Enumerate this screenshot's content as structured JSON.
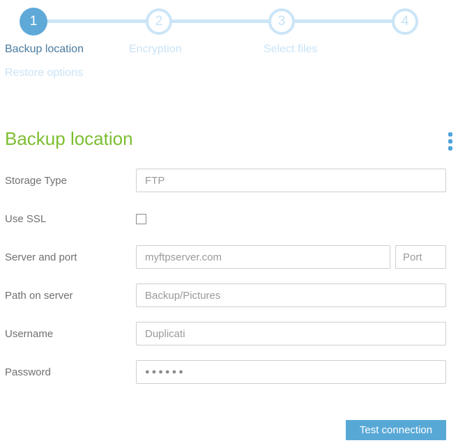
{
  "stepper": {
    "steps": [
      {
        "number": "1",
        "label": "Backup location",
        "active": true
      },
      {
        "number": "2",
        "label": "Encryption",
        "active": false
      },
      {
        "number": "3",
        "label": "Select files",
        "active": false
      },
      {
        "number": "4",
        "label": "Restore options",
        "active": false
      }
    ]
  },
  "main": {
    "title": "Backup location"
  },
  "form": {
    "storage_type_label": "Storage Type",
    "storage_type_value": "FTP",
    "use_ssl_label": "Use SSL",
    "use_ssl_checked": false,
    "server_label": "Server and port",
    "server_value": "myftpserver.com",
    "port_placeholder": "Port",
    "path_label": "Path on server",
    "path_value": "Backup/Pictures",
    "username_label": "Username",
    "username_value": "Duplicati",
    "password_label": "Password",
    "password_value": "●●●●●●"
  },
  "footer": {
    "test_connection_label": "Test connection"
  },
  "colors": {
    "accent_blue": "#5fa9d8",
    "light_blue": "#cbe5f7",
    "active_step_label": "#4a7ba0",
    "heading_green": "#7cbe31",
    "button_blue": "#58a8d6"
  }
}
